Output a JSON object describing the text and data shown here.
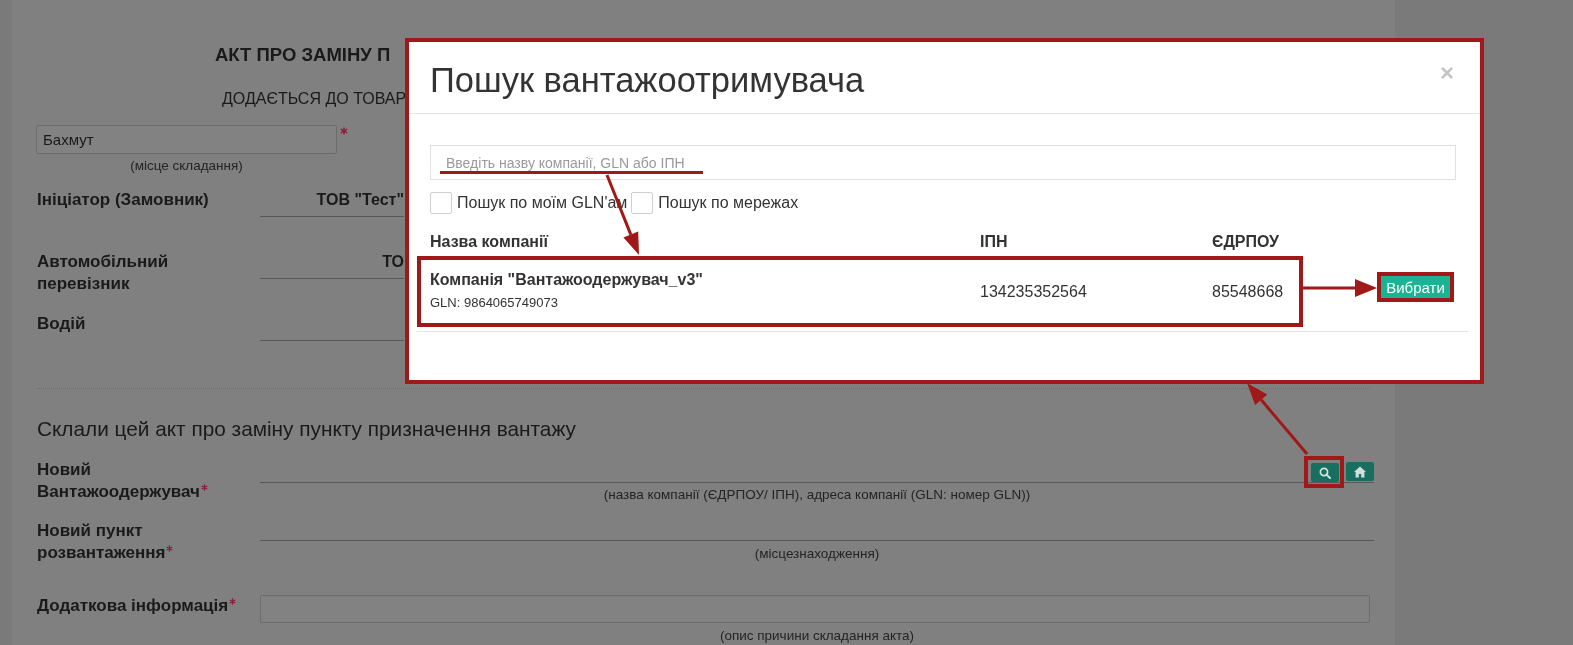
{
  "page": {
    "title": "АКТ ПРО ЗАМІНУ П",
    "subtitle": "ДОДАЄТЬСЯ ДО ТОВАР",
    "place": {
      "value": "Бахмут",
      "required": true,
      "hint": "(місце складання)"
    },
    "parties": [
      {
        "label": "Ініціатор (Замовник)",
        "value": "ТОВ \"Тест\""
      },
      {
        "label": "Автомобільний перевізник",
        "value": "ТО"
      },
      {
        "label": "Водій"
      }
    ],
    "section_title": "Склали цей акт про заміну пункту призначення вантажу",
    "fields": [
      {
        "kind": "lookup",
        "label": "Новий Вантажоодержувач",
        "required": true,
        "hint": "(назва компанії (ЄДРПОУ/ ІПН), адреса компанії (GLN: номер GLN))"
      },
      {
        "kind": "line",
        "label": "Новий пункт розвантаження",
        "required": true,
        "hint": "(місцезнаходження)"
      },
      {
        "kind": "box",
        "label": "Додаткова інформація",
        "required": true,
        "hint": "(опис причини складання акта)"
      }
    ]
  },
  "dialog": {
    "title": "Пошук вантажоотримувача",
    "close": "×",
    "search": {
      "placeholder": "Введіть назву компанії, GLN або ІПН"
    },
    "filters": [
      {
        "label": "Пошук по моїм GLN'ам",
        "checked": false
      },
      {
        "label": "Пошук по мережах",
        "checked": false
      }
    ],
    "table": {
      "columns": [
        "Назва компанії",
        "ІПН",
        "ЄДРПОУ"
      ],
      "rows": [
        {
          "name": "Компанія \"Вантажоодержувач_v3\"",
          "gln": "GLN: 9864065749073",
          "ipn": "134235352564",
          "edrpou": "85548668",
          "action": "Вибрати"
        }
      ]
    }
  }
}
